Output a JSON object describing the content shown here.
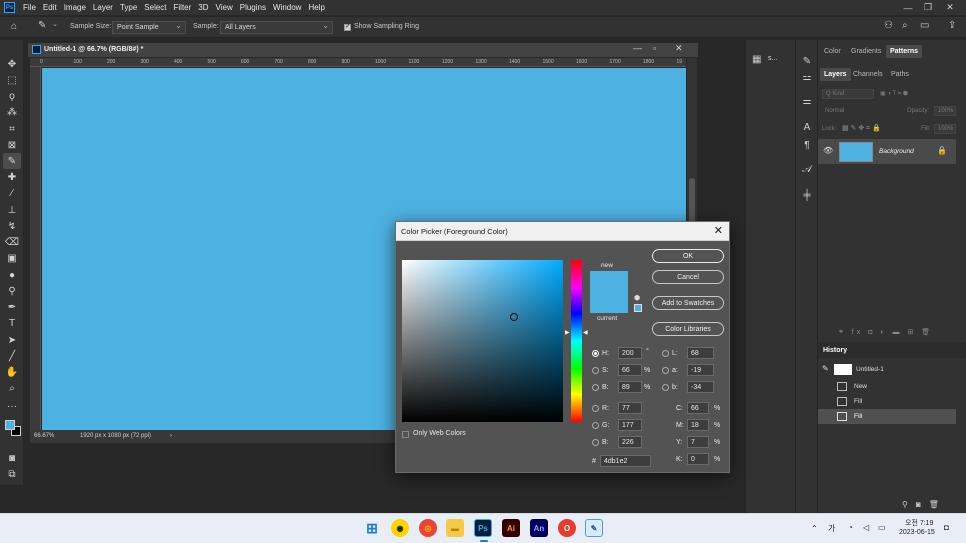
{
  "menu": {
    "items": [
      "File",
      "Edit",
      "Image",
      "Layer",
      "Type",
      "Select",
      "Filter",
      "3D",
      "View",
      "Plugins",
      "Window",
      "Help"
    ]
  },
  "options": {
    "sample_size_label": "Sample Size:",
    "sample_size_value": "Point Sample",
    "sample_label": "Sample:",
    "sample_value": "All Layers",
    "show_ring_label": "Show Sampling Ring"
  },
  "document": {
    "tab_title": "Untitled-1 @ 66.7% (RGB/8#) *",
    "ruler_ticks": [
      "0",
      "100",
      "200",
      "300",
      "400",
      "500",
      "600",
      "700",
      "800",
      "900",
      "1000",
      "1100",
      "1200",
      "1300",
      "1400",
      "1500",
      "1600",
      "1700",
      "1800",
      "19"
    ],
    "zoom": "66.67%",
    "doc_info": "1920 px x 1080 px (72 ppi)",
    "canvas_color": "#4db1e2"
  },
  "midcol": {
    "label": "s..."
  },
  "panels": {
    "top_tabs": [
      "Color",
      "Gradients",
      "Patterns"
    ],
    "layer_tabs": [
      "Layers",
      "Channels",
      "Paths"
    ],
    "kind_label": "Q Kind",
    "blend_mode": "Normal",
    "opacity_label": "Opacity:",
    "opacity_value": "100%",
    "lock_label": "Lock:",
    "fill_label": "Fill:",
    "fill_value": "100%",
    "layer_name": "Background",
    "history_title": "History",
    "history_items": [
      "Untitled-1",
      "New",
      "Fill",
      "Fill"
    ]
  },
  "picker": {
    "title": "Color Picker (Foreground Color)",
    "ok": "OK",
    "cancel": "Cancel",
    "add_swatches": "Add to Swatches",
    "libraries": "Color Libraries",
    "new_label": "new",
    "current_label": "current",
    "only_web": "Only Web Colors",
    "H": "200",
    "S": "66",
    "B": "89",
    "R": "77",
    "G": "177",
    "Bv": "226",
    "L": "68",
    "a": "-19",
    "b": "-34",
    "C": "66",
    "M": "18",
    "Y": "7",
    "K": "0",
    "hex": "4db1e2",
    "H_unit": "°",
    "pct": "%",
    "labels": {
      "H": "H:",
      "S": "S:",
      "B": "B:",
      "R": "R:",
      "G": "G:",
      "Bv": "B:",
      "L": "L:",
      "a": "a:",
      "b": "b:",
      "C": "C:",
      "M": "M:",
      "Y": "Y:",
      "K": "K:",
      "hex": "#"
    }
  },
  "taskbar": {
    "apps": [
      "Ps",
      "Ai",
      "An"
    ],
    "ime": "가",
    "time": "오전 7:19",
    "date": "2023-06-15"
  },
  "colors": {
    "accent": "#31a8ff",
    "canvas": "#4db1e2"
  }
}
